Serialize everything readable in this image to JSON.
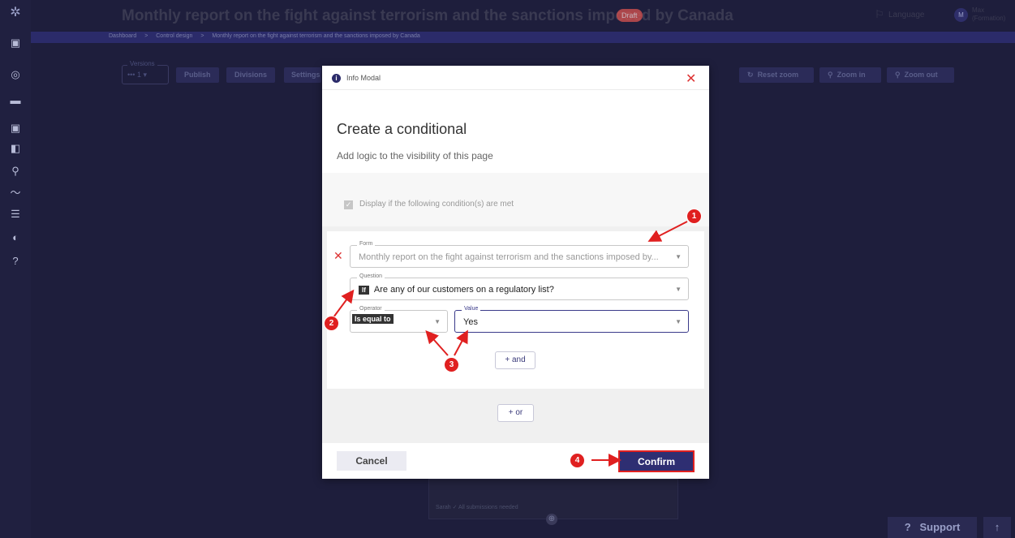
{
  "header": {
    "title": "Monthly report on the fight against terrorism and the sanctions imposed by Canada",
    "badge": "Draft",
    "language_label": "Language",
    "user_initial": "M",
    "user_name_line1": "Max",
    "user_name_line2": "(Formation)"
  },
  "breadcrumb": {
    "items": [
      "Dashboard",
      "Control design",
      "Monthly report on the fight against terrorism and the sanctions imposed by Canada"
    ],
    "separator": ">"
  },
  "toolbar": {
    "versions_label": "Versions",
    "versions_value": "1",
    "publish_label": "Publish",
    "divisions_label": "Divisions",
    "settings_label": "Settings",
    "reset_zoom_label": "Reset zoom",
    "zoom_in_label": "Zoom in",
    "zoom_out_label": "Zoom out"
  },
  "canvas": {
    "card_info": "Sarah ✓ All submissions needed"
  },
  "support": {
    "label": "Support",
    "question_mark": "?"
  },
  "modal": {
    "header_title": "Info Modal",
    "title": "Create a conditional",
    "subtitle": "Add logic to the visibility of this page",
    "checkbox_label": "Display if the following condition(s) are met",
    "form_label": "Form",
    "form_value": "Monthly report on the fight against terrorism and the sanctions imposed by...",
    "question_label": "Question",
    "question_badge": "If",
    "question_value": "Are any of our customers on a regulatory list?",
    "operator_label": "Operator",
    "operator_value": "Is equal to",
    "value_label": "Value",
    "value_value": "Yes",
    "and_label": "+  and",
    "or_label": "+  or",
    "cancel_label": "Cancel",
    "confirm_label": "Confirm"
  },
  "annotations": {
    "markers": [
      "1",
      "2",
      "3",
      "4"
    ],
    "color": "#e02020"
  },
  "colors": {
    "background": "#1e1e3c",
    "primary": "#2e2e72",
    "danger": "#d33333"
  }
}
